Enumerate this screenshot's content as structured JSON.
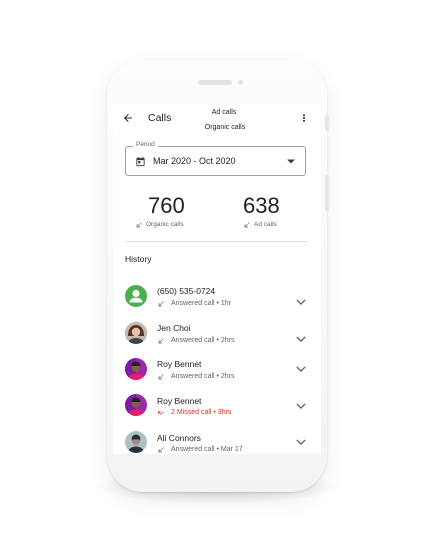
{
  "app": {
    "title": "Calls",
    "filters": [
      "Ad calls",
      "Organic calls"
    ]
  },
  "period": {
    "label": "Period",
    "value": "Mar 2020 - Oct 2020"
  },
  "stats": [
    {
      "value": "760",
      "label": "Organic calls"
    },
    {
      "value": "638",
      "label": "Ad calls"
    }
  ],
  "history": {
    "title": "History",
    "items": [
      {
        "name": "(650) 535-0724",
        "status": "Answered call • 1hr",
        "type": "answered",
        "avatar": "default-person"
      },
      {
        "name": "Jen Choi",
        "status": "Answered call • 2hrs",
        "type": "answered",
        "avatar": "photo"
      },
      {
        "name": "Roy Bennet",
        "status": "Answered call • 2hrs",
        "type": "answered",
        "avatar": "photo"
      },
      {
        "name": "Roy Bennet",
        "status": "2 Missed call • 3hrs",
        "type": "missed",
        "avatar": "photo"
      },
      {
        "name": "Ali Connors",
        "status": "Answered call • Mar 17",
        "type": "answered",
        "avatar": "photo"
      }
    ]
  },
  "colors": {
    "missed": "#d93025",
    "avatar_default": "#4caf50",
    "text_secondary": "#5f6368"
  }
}
